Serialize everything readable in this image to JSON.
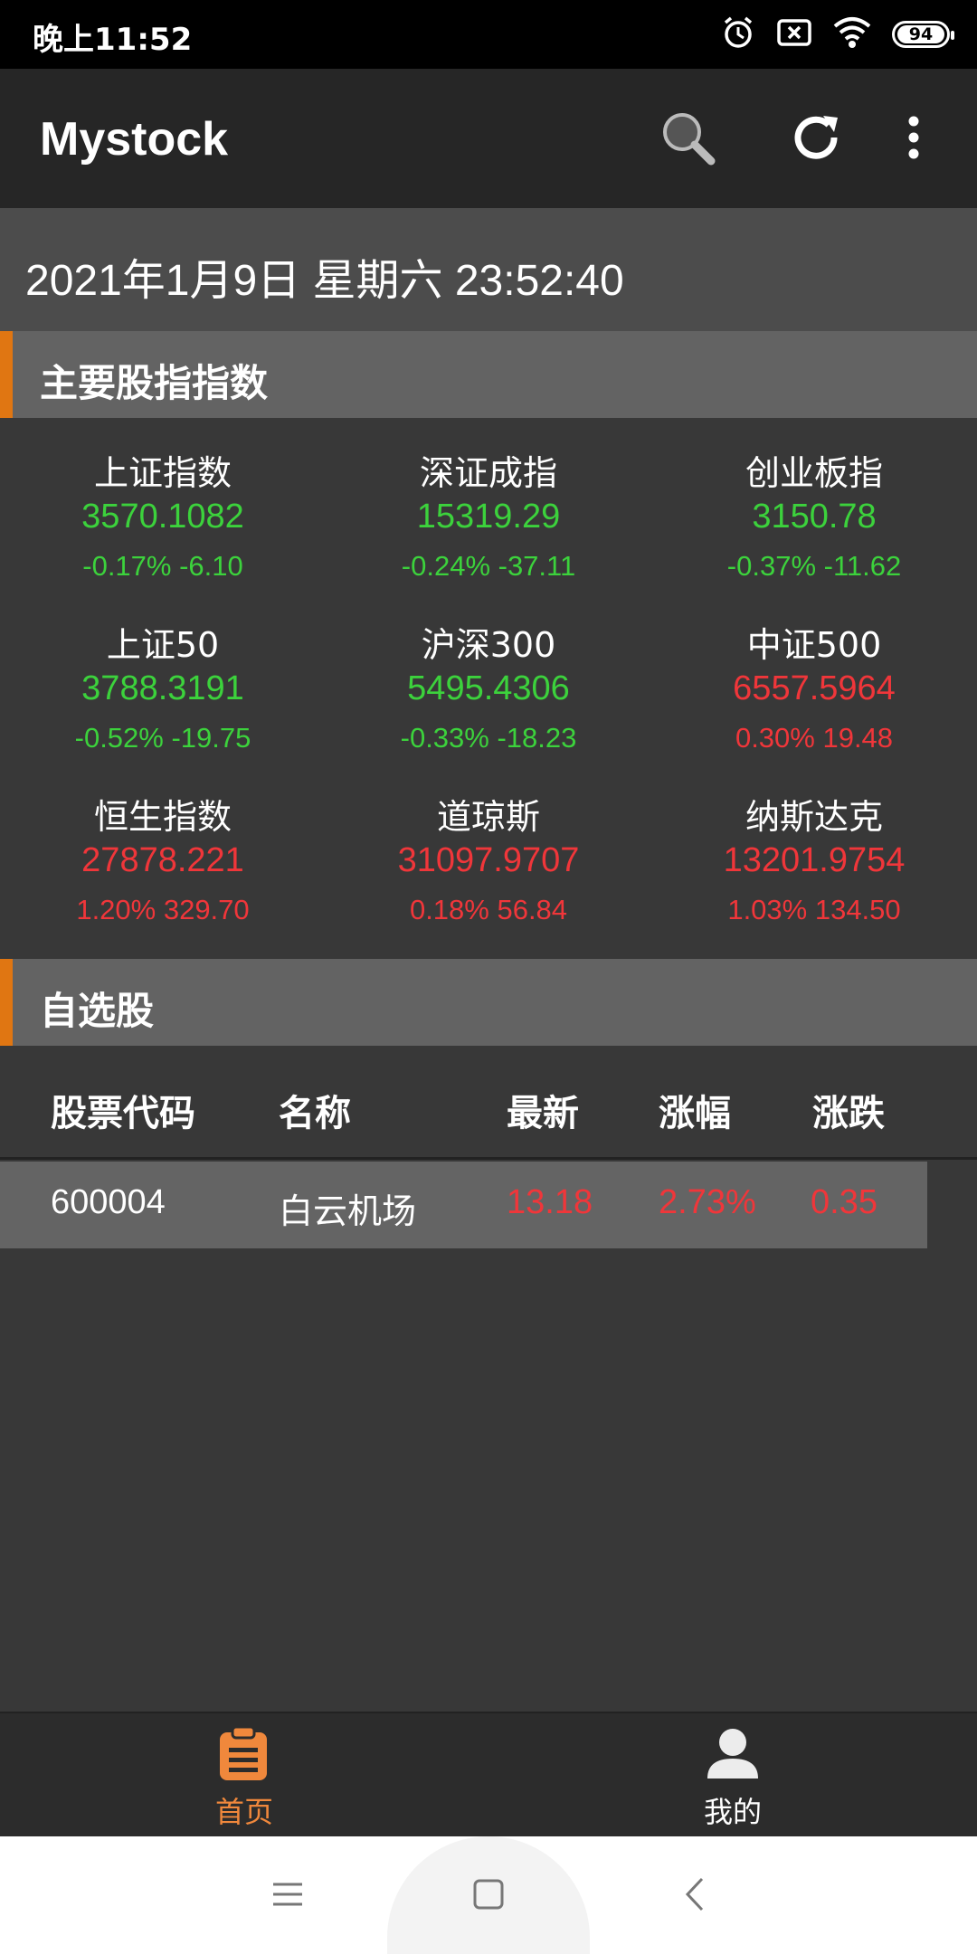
{
  "status_bar": {
    "time": "晚上11:52",
    "battery": "94",
    "icons": [
      "alarm-icon",
      "sim-off-icon",
      "wifi-icon",
      "battery-icon"
    ]
  },
  "app_bar": {
    "title": "Mystock",
    "actions": [
      "search-icon",
      "refresh-icon",
      "more-vert-icon"
    ]
  },
  "date_time": "2021年1月9日 星期六  23:52:40",
  "indices_section": {
    "title": "主要股指指数",
    "items": [
      {
        "name": "上证指数",
        "value": "3570.1082",
        "change": "-0.17% -6.10",
        "trend": "down"
      },
      {
        "name": "深证成指",
        "value": "15319.29",
        "change": "-0.24% -37.11",
        "trend": "down"
      },
      {
        "name": "创业板指",
        "value": "3150.78",
        "change": "-0.37% -11.62",
        "trend": "down"
      },
      {
        "name": "上证50",
        "value": "3788.3191",
        "change": "-0.52% -19.75",
        "trend": "down"
      },
      {
        "name": "沪深300",
        "value": "5495.4306",
        "change": "-0.33% -18.23",
        "trend": "down"
      },
      {
        "name": "中证500",
        "value": "6557.5964",
        "change": "0.30% 19.48",
        "trend": "up"
      },
      {
        "name": "恒生指数",
        "value": "27878.221",
        "change": "1.20% 329.70",
        "trend": "up"
      },
      {
        "name": "道琼斯",
        "value": "31097.9707",
        "change": "0.18% 56.84",
        "trend": "up"
      },
      {
        "name": "纳斯达克",
        "value": "13201.9754",
        "change": "1.03% 134.50",
        "trend": "up"
      }
    ]
  },
  "watchlist_section": {
    "title": "自选股",
    "columns": [
      "股票代码",
      "名称",
      "最新",
      "涨幅",
      "涨跌"
    ],
    "rows": [
      {
        "code": "600004",
        "name": "白云机场",
        "latest": "13.18",
        "pct": "2.73%",
        "change": "0.35"
      }
    ]
  },
  "bottom_nav": {
    "items": [
      {
        "label": "首页",
        "icon": "clipboard-icon",
        "active": true
      },
      {
        "label": "我的",
        "icon": "person-icon",
        "active": false
      }
    ]
  },
  "system_nav": [
    "menu-icon",
    "home-icon",
    "back-icon"
  ],
  "colors": {
    "up": "#f0363a",
    "down": "#3cd23c",
    "accent": "#e07612",
    "nav_active": "#f0883c"
  }
}
